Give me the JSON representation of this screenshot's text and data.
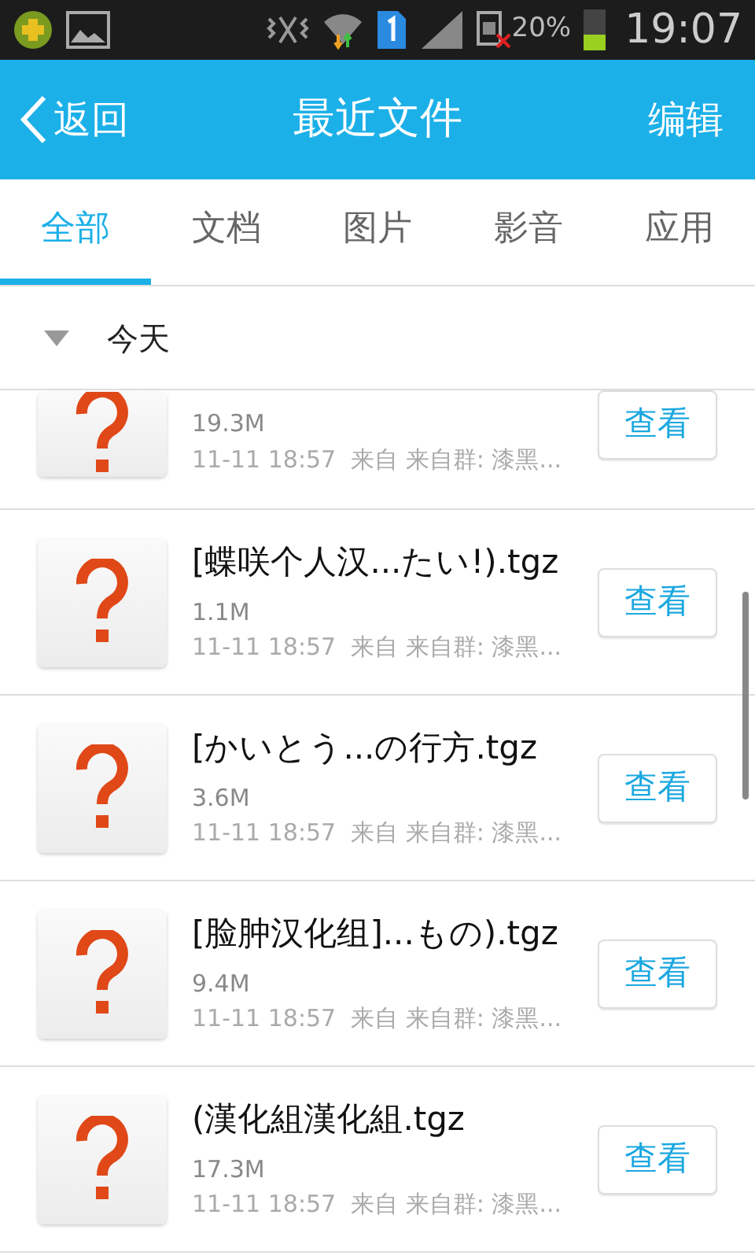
{
  "status_bar": {
    "battery_text": "20%",
    "time": "19:07"
  },
  "header": {
    "back": "返回",
    "title": "最近文件",
    "action": "编辑"
  },
  "tabs": [
    {
      "label": "全部",
      "selected": true
    },
    {
      "label": "文档",
      "selected": false
    },
    {
      "label": "图片",
      "selected": false
    },
    {
      "label": "影音",
      "selected": false
    },
    {
      "label": "应用",
      "selected": false
    }
  ],
  "section": {
    "title": "今天",
    "expanded": true
  },
  "files": [
    {
      "size": "19.3M",
      "meta": "11-11 18:57  来自 来自群: 漆黑...",
      "button": "查看"
    },
    {
      "name": "[蝶咲个人汉...たい!).tgz",
      "size": "1.1M",
      "meta": "11-11 18:57  来自 来自群: 漆黑...",
      "button": "查看"
    },
    {
      "name": "[かいとう...の行方.tgz",
      "size": "3.6M",
      "meta": "11-11 18:57  来自 来自群: 漆黑...",
      "button": "查看"
    },
    {
      "name": "[脸肿汉化组]...もの).tgz",
      "size": "9.4M",
      "meta": "11-11 18:57  来自 来自群: 漆黑...",
      "button": "查看"
    },
    {
      "name": "(漢化組漢化組.tgz",
      "size": "17.3M",
      "meta": "11-11 18:57  来自 来自群: 漆黑...",
      "button": "查看"
    }
  ]
}
